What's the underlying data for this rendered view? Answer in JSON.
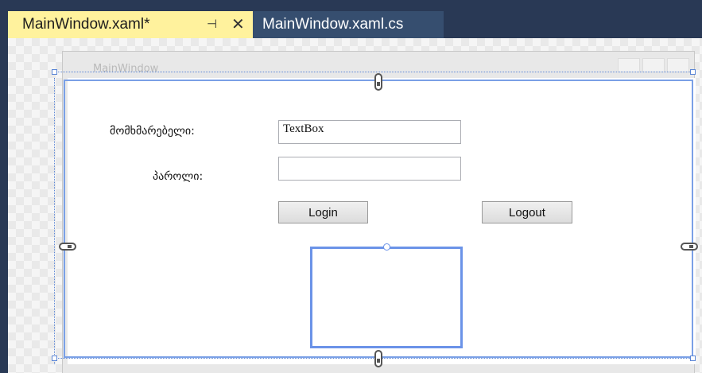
{
  "tabs": [
    {
      "label": "MainWindow.xaml*",
      "active": true,
      "pin_icon": "pin-icon",
      "close_icon": "close-icon"
    },
    {
      "label": "MainWindow.xaml.cs",
      "active": false
    }
  ],
  "window": {
    "title": "MainWindow"
  },
  "form": {
    "username_label": "მომხმარებელი:",
    "username_value": "TextBox",
    "password_label": "პაროლი:",
    "password_value": "",
    "login_label": "Login",
    "logout_label": "Logout"
  },
  "colors": {
    "tab_active": "#fff29d",
    "tab_inactive": "#364e6f",
    "chrome": "#293955",
    "selection": "#7aa0e6"
  }
}
